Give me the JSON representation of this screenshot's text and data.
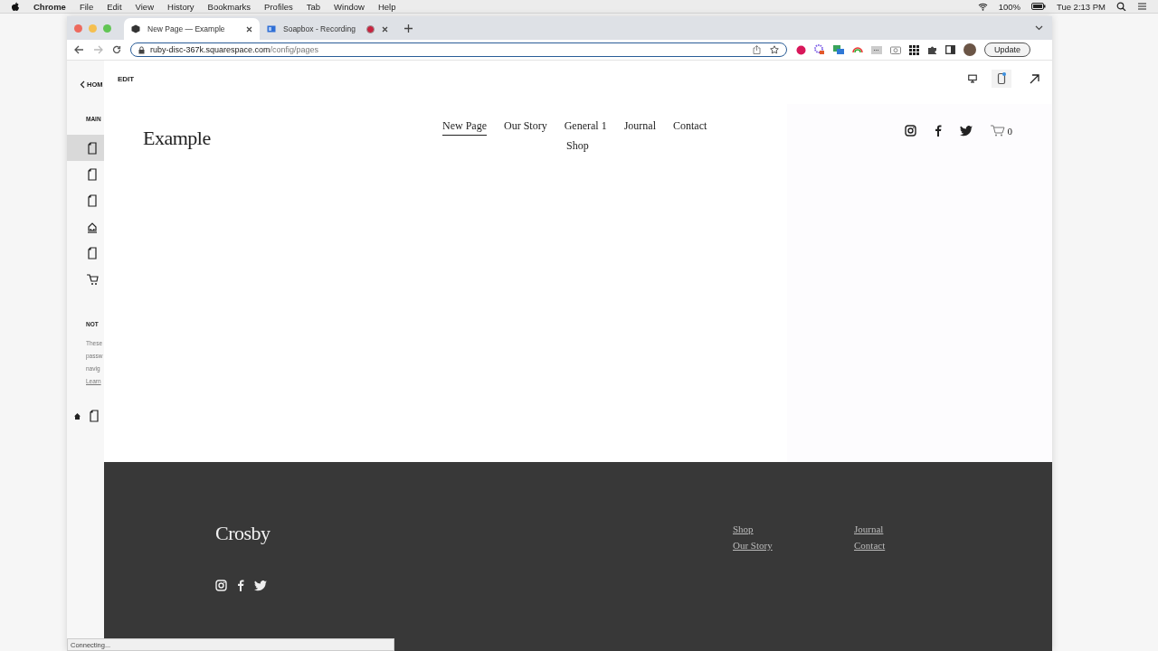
{
  "menu_bar": {
    "app": "Chrome",
    "items": [
      "File",
      "Edit",
      "View",
      "History",
      "Bookmarks",
      "Profiles",
      "Tab",
      "Window",
      "Help"
    ],
    "battery": "100%",
    "clock": "Tue 2:13 PM"
  },
  "tabs": [
    {
      "title": "New Page — Example",
      "selected": true,
      "recording": false
    },
    {
      "title": "Soapbox - Recording",
      "selected": false,
      "recording": true
    }
  ],
  "address_bar": {
    "host": "ruby-disc-367k.squarespace.com",
    "path": "/config/pages"
  },
  "update_button": "Update",
  "sidebar": {
    "back_link": "HOM",
    "section_title": "MAIN",
    "items": [
      {
        "kind": "page",
        "selected": true
      },
      {
        "kind": "page",
        "selected": false
      },
      {
        "kind": "page",
        "selected": false
      },
      {
        "kind": "home-page",
        "selected": false
      },
      {
        "kind": "page",
        "selected": false
      },
      {
        "kind": "cart",
        "selected": false
      }
    ],
    "not_linked_title": "NOT",
    "note_lines": [
      "These",
      "passw",
      "navig"
    ],
    "learn_link": "Learn",
    "unlinked_items": [
      {
        "kind": "page",
        "home": true
      }
    ]
  },
  "editor": {
    "edit_label": "EDIT",
    "device_buttons": [
      {
        "kind": "desktop",
        "selected": false
      },
      {
        "kind": "mobile",
        "selected": true
      }
    ]
  },
  "site": {
    "logo": "Example",
    "nav": [
      {
        "label": "New Page",
        "selected": true
      },
      {
        "label": "Our Story",
        "selected": false
      },
      {
        "label": "General 1",
        "selected": false
      },
      {
        "label": "Journal",
        "selected": false
      },
      {
        "label": "Contact",
        "selected": false
      },
      {
        "label": "Shop",
        "selected": false
      }
    ],
    "cart_count": "0"
  },
  "footer": {
    "logo": "Crosby",
    "links": [
      "Shop",
      "Journal",
      "Our Story",
      "Contact"
    ]
  },
  "status_bar": "Connecting..."
}
